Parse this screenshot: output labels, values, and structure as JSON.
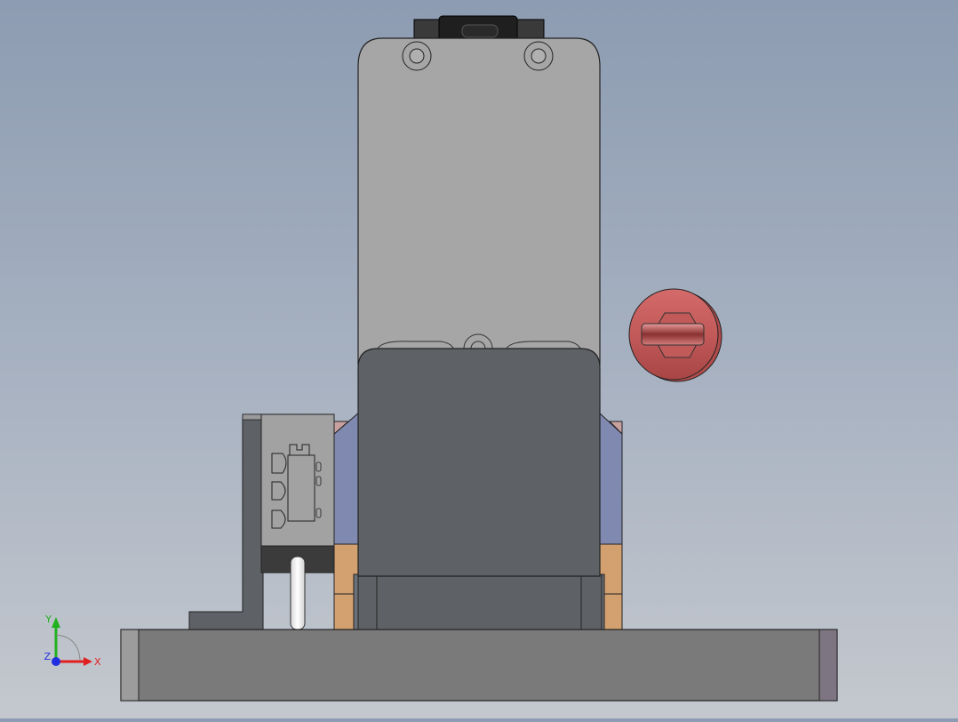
{
  "scene": {
    "colors": {
      "background_top": "#8d9cb2",
      "background_bottom": "#c4c8ce",
      "motor_can": "#a6a6a6",
      "gearbox": "#5e6166",
      "base_plate": "#7a7a7a",
      "side_bracket": "#808ab0",
      "wood_blocks": "#d3a070",
      "knob": "#c25a5a",
      "switch_body": "#a2a2a2"
    },
    "parts": [
      "motor-can",
      "gearbox-housing",
      "base-plate",
      "limit-switch",
      "l-bracket",
      "side-plates",
      "spacer-blocks",
      "rotary-knob",
      "connector-top"
    ]
  },
  "triad": {
    "x_label": "X",
    "y_label": "Y",
    "z_label": "Z",
    "x_color": "#e02020",
    "y_color": "#20b020",
    "z_color": "#2030e0"
  }
}
